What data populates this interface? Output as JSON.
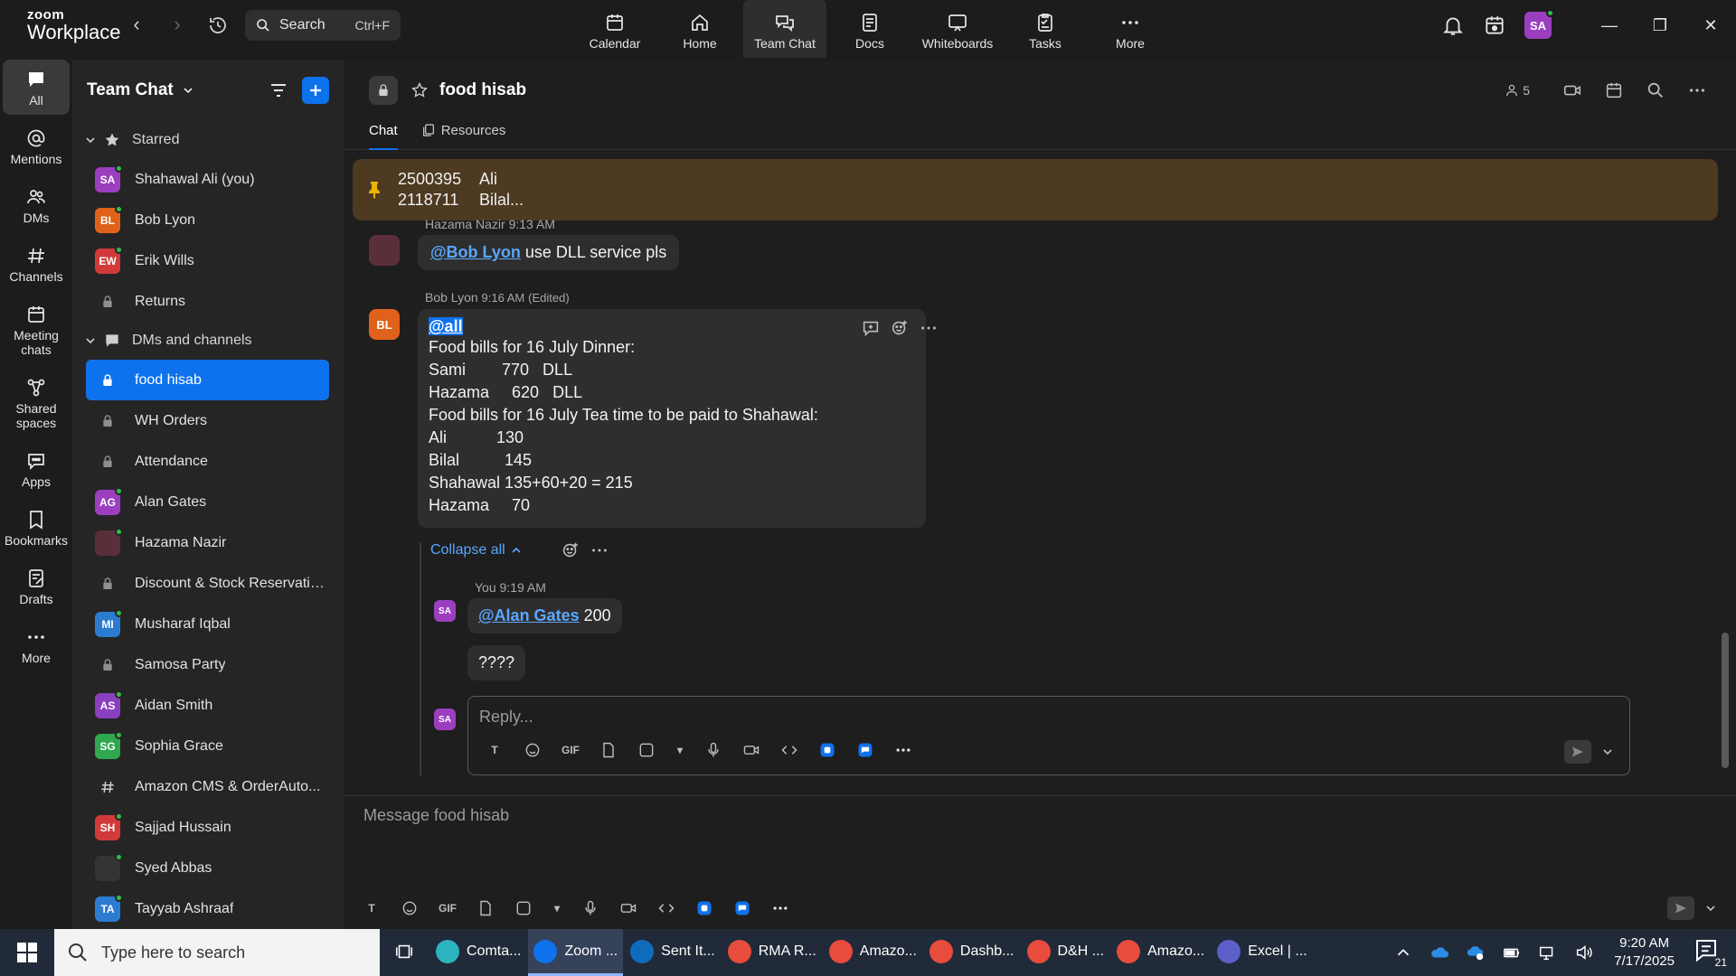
{
  "app": {
    "logo_line1": "zoom",
    "logo_line2": "Workplace"
  },
  "search": {
    "label": "Search",
    "shortcut": "Ctrl+F"
  },
  "top_nav": [
    {
      "label": "Calendar",
      "icon": "calendar-icon"
    },
    {
      "label": "Home",
      "icon": "home-icon"
    },
    {
      "label": "Team Chat",
      "icon": "team-chat-icon",
      "active": true
    },
    {
      "label": "Docs",
      "icon": "docs-icon"
    },
    {
      "label": "Whiteboards",
      "icon": "whiteboard-icon"
    },
    {
      "label": "Tasks",
      "icon": "tasks-icon"
    },
    {
      "label": "More",
      "icon": "more-icon"
    }
  ],
  "user": {
    "initials": "SA"
  },
  "rail": [
    {
      "label": "All",
      "active": true
    },
    {
      "label": "Mentions"
    },
    {
      "label": "DMs"
    },
    {
      "label": "Channels"
    },
    {
      "label": "Meeting chats"
    },
    {
      "label": "Shared spaces"
    },
    {
      "label": "Apps"
    },
    {
      "label": "Bookmarks"
    },
    {
      "label": "Drafts"
    },
    {
      "label": "More"
    }
  ],
  "sidebar": {
    "title": "Team Chat",
    "starred_label": "Starred",
    "starred": [
      {
        "type": "avatar",
        "initials": "SA",
        "color": "#9b3fbf",
        "label": "Shahawal Ali (you)",
        "online": true
      },
      {
        "type": "avatar",
        "initials": "BL",
        "color": "#e0621a",
        "label": "Bob Lyon",
        "online": true
      },
      {
        "type": "avatar",
        "initials": "EW",
        "color": "#d23a3a",
        "label": "Erik Wills",
        "online": true
      },
      {
        "type": "lock",
        "label": "Returns"
      }
    ],
    "dm_label": "DMs and channels",
    "dms": [
      {
        "type": "lock",
        "label": "food hisab",
        "active": true
      },
      {
        "type": "lock",
        "label": "WH Orders"
      },
      {
        "type": "lock",
        "label": "Attendance"
      },
      {
        "type": "avatar",
        "initials": "AG",
        "color": "#9b3fbf",
        "label": "Alan Gates",
        "online": true
      },
      {
        "type": "avatar",
        "initials": "",
        "color": "#5a2f3a",
        "label": "Hazama Nazir",
        "online": true
      },
      {
        "type": "lock",
        "label": "Discount & Stock Reservatio..."
      },
      {
        "type": "avatar",
        "initials": "MI",
        "color": "#2b7bd0",
        "label": "Musharaf Iqbal",
        "online": true
      },
      {
        "type": "lock",
        "label": "Samosa Party"
      },
      {
        "type": "avatar",
        "initials": "AS",
        "color": "#8a3fbf",
        "label": "Aidan Smith",
        "online": true
      },
      {
        "type": "avatar",
        "initials": "SG",
        "color": "#2fa84f",
        "label": "Sophia Grace",
        "online": true
      },
      {
        "type": "hash",
        "label": "Amazon CMS & OrderAuto..."
      },
      {
        "type": "avatar",
        "initials": "SH",
        "color": "#d23a3a",
        "label": "Sajjad Hussain",
        "online": true
      },
      {
        "type": "avatar",
        "initials": "",
        "color": "#333333",
        "label": "Syed Abbas",
        "online": true
      },
      {
        "type": "avatar",
        "initials": "TA",
        "color": "#2b7bd0",
        "label": "Tayyab Ashraaf",
        "online": true
      }
    ]
  },
  "channel": {
    "name": "food hisab",
    "member_count": "5",
    "tabs": [
      "Chat",
      "Resources"
    ],
    "pinned": [
      {
        "a": "2500395",
        "b": "Ali"
      },
      {
        "a": "2118711",
        "b": "Bilal..."
      }
    ]
  },
  "messages": {
    "m1": {
      "meta": "Hazama Nazir 9:13 AM",
      "mention": "@Bob Lyon",
      "text": " use DLL service pls"
    },
    "m2": {
      "author": "Bob Lyon",
      "time": "9:16 AM",
      "edited": "(Edited)",
      "initials": "BL",
      "mention": "@all",
      "lines": [
        "Food bills for 16 July Dinner:",
        "Sami        770   DLL",
        "Hazama     620   DLL",
        "Food bills for 16 July Tea time to be paid to Shahawal:",
        "Ali           130",
        "Bilal          145",
        "Shahawal 135+60+20 = 215",
        "Hazama     70"
      ]
    },
    "thread": {
      "collapse_label": "Collapse all",
      "reply_meta": "You 9:19 AM",
      "reply_initials": "SA",
      "reply_mention": "@Alan Gates",
      "reply_text": " 200",
      "reply2": "????",
      "reply_placeholder": "Reply..."
    }
  },
  "composer": {
    "placeholder": "Message food hisab"
  },
  "taskbar": {
    "search_placeholder": "Type here to search",
    "apps": [
      {
        "label": "Comta...",
        "color": "#2bb3c0"
      },
      {
        "label": "Zoom ...",
        "color": "#0e72ed",
        "active": true
      },
      {
        "label": "Sent It...",
        "color": "#0f6cbd"
      },
      {
        "label": "RMA R...",
        "color": "#e74c3c"
      },
      {
        "label": "Amazo...",
        "color": "#e74c3c"
      },
      {
        "label": "Dashb...",
        "color": "#e74c3c"
      },
      {
        "label": "D&H ...",
        "color": "#e74c3c"
      },
      {
        "label": "Amazo...",
        "color": "#e74c3c"
      },
      {
        "label": "Excel | ...",
        "color": "#5b5fc7"
      }
    ],
    "time": "9:20 AM",
    "date": "7/17/2025",
    "notifications": "21"
  }
}
